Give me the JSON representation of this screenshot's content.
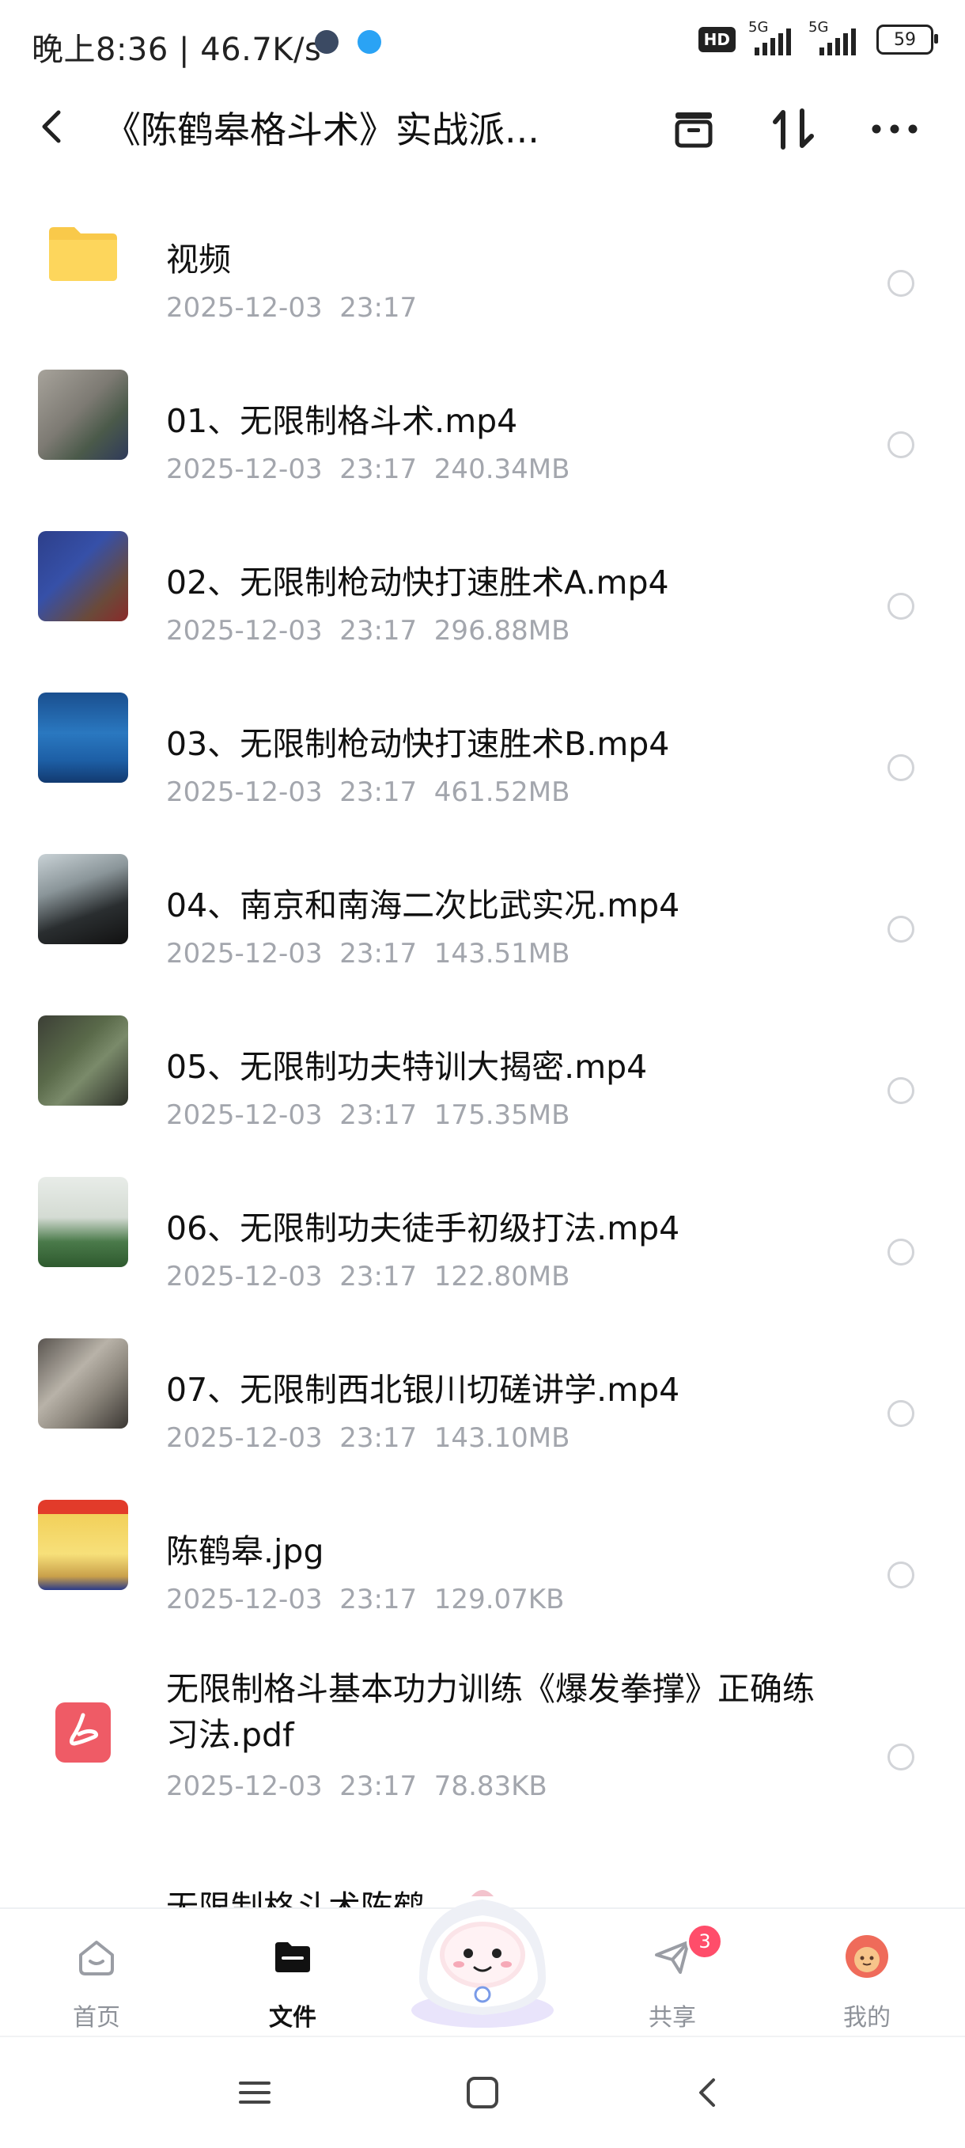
{
  "status_bar": {
    "time": "晚上8:36 | 46.7K/s",
    "hd": "HD",
    "signal1": "5G",
    "signal2": "5G",
    "battery": "59"
  },
  "header": {
    "title": "《陈鹤皋格斗术》实战派...",
    "icons": [
      "back-icon",
      "archive-icon",
      "sort-icon",
      "more-icon"
    ]
  },
  "files": [
    {
      "name": "视频",
      "meta": "2025-12-03  23:17",
      "type": "folder"
    },
    {
      "name": "01、无限制格斗术.mp4",
      "meta": "2025-12-03  23:17  240.34MB",
      "type": "video"
    },
    {
      "name": "02、无限制枪动快打速胜术A.mp4",
      "meta": "2025-12-03  23:17  296.88MB",
      "type": "video"
    },
    {
      "name": "03、无限制枪动快打速胜术B.mp4",
      "meta": "2025-12-03  23:17  461.52MB",
      "type": "video"
    },
    {
      "name": "04、南京和南海二次比武实况.mp4",
      "meta": "2025-12-03  23:17  143.51MB",
      "type": "video"
    },
    {
      "name": "05、无限制功夫特训大揭密.mp4",
      "meta": "2025-12-03  23:17  175.35MB",
      "type": "video"
    },
    {
      "name": "06、无限制功夫徒手初级打法.mp4",
      "meta": "2025-12-03  23:17  122.80MB",
      "type": "video"
    },
    {
      "name": "07、无限制西北银川切磋讲学.mp4",
      "meta": "2025-12-03  23:17  143.10MB",
      "type": "video"
    },
    {
      "name": "陈鹤皋.jpg",
      "meta": "2025-12-03  23:17  129.07KB",
      "type": "image"
    },
    {
      "name": "无限制格斗基本功力训练《爆发拳撑》正确练习法.pdf",
      "meta": "2025-12-03  23:17  78.83KB",
      "type": "pdf"
    },
    {
      "name": "无限制格斗术陈鹤",
      "meta": "",
      "type": "pdf"
    }
  ],
  "nav": {
    "home": "首页",
    "files": "文件",
    "share": "共享",
    "share_badge": "3",
    "me": "我的"
  },
  "colors": {
    "accent_folder": "#f9c94a",
    "pdf_red": "#ef5b66",
    "badge": "#ff4d6a"
  }
}
